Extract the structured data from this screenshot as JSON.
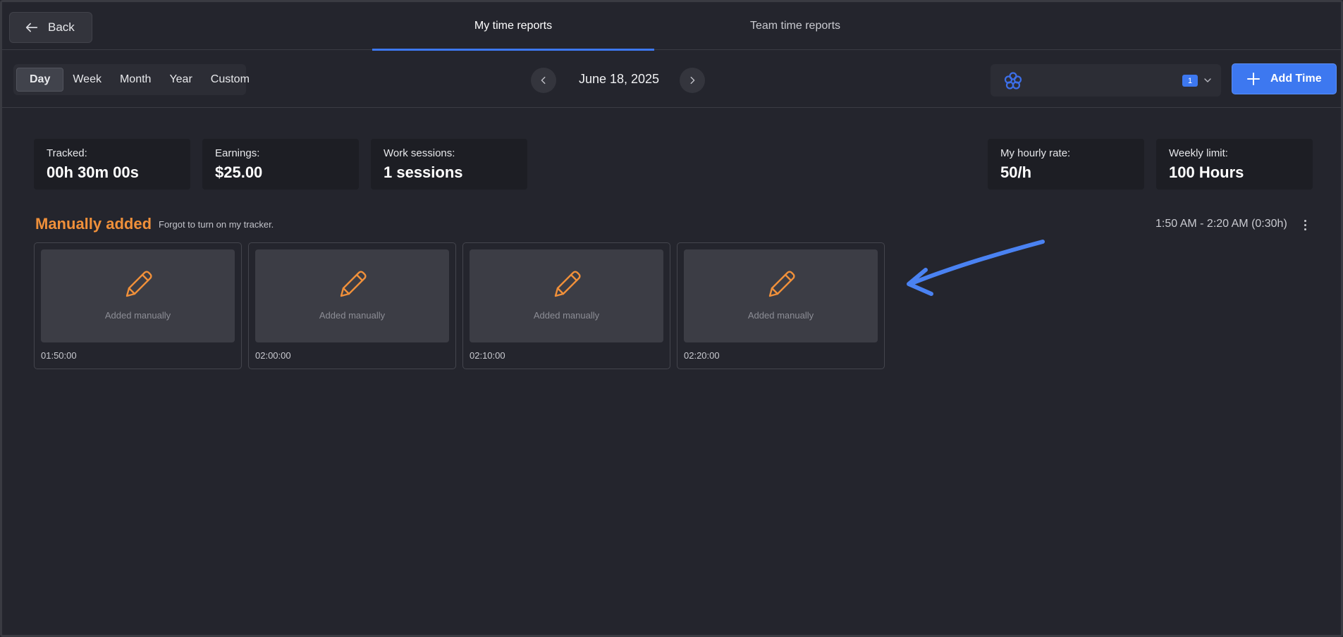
{
  "header": {
    "back_label": "Back",
    "tabs": [
      {
        "label": "My time reports",
        "active": true
      },
      {
        "label": "Team time reports",
        "active": false
      }
    ]
  },
  "toolbar": {
    "periods": [
      "Day",
      "Week",
      "Month",
      "Year",
      "Custom"
    ],
    "active_period": "Day",
    "date": "June 18, 2025",
    "team_badge": "1",
    "add_label": "Add Time"
  },
  "stats": {
    "tracked": {
      "label": "Tracked:",
      "value": "00h 30m 00s"
    },
    "earnings": {
      "label": "Earnings:",
      "value": "$25.00"
    },
    "sessions": {
      "label": "Work sessions:",
      "value": "1 sessions"
    },
    "rate": {
      "label": "My hourly rate:",
      "value": "50/h"
    },
    "limit": {
      "label": "Weekly limit:",
      "value": "100 Hours"
    }
  },
  "session": {
    "title": "Manually added",
    "note": "Forgot to turn on my tracker.",
    "range": "1:50 AM - 2:20 AM (0:30h)",
    "cards": [
      {
        "caption": "Added manually",
        "time": "01:50:00"
      },
      {
        "caption": "Added manually",
        "time": "02:00:00"
      },
      {
        "caption": "Added manually",
        "time": "02:10:00"
      },
      {
        "caption": "Added manually",
        "time": "02:20:00"
      }
    ]
  },
  "colors": {
    "background": "#24252d",
    "accent": "#3d78f0",
    "section_title": "#f0903a",
    "annotation_arrow": "#4a82f2"
  },
  "icons": [
    "arrow-left-icon",
    "chevron-left-icon",
    "chevron-right-icon",
    "team-logo-icon",
    "chevron-down-icon",
    "plus-icon",
    "kebab-menu-icon",
    "pencil-icon"
  ]
}
